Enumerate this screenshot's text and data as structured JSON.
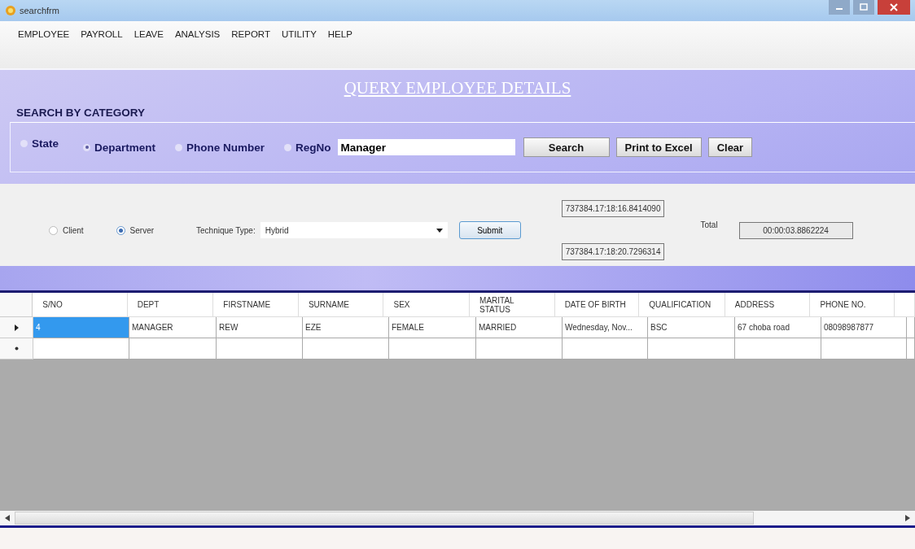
{
  "window": {
    "title": "searchfrm"
  },
  "menu": [
    {
      "label": "EMPLOYEE"
    },
    {
      "label": "PAYROLL"
    },
    {
      "label": "LEAVE"
    },
    {
      "label": "ANALYSIS"
    },
    {
      "label": "REPORT"
    },
    {
      "label": "UTILITY"
    },
    {
      "label": "HELP"
    }
  ],
  "header": {
    "title": "QUERY EMPLOYEE DETAILS"
  },
  "search_group": {
    "label": "SEARCH BY CATEGORY",
    "options": [
      {
        "label": "State",
        "selected": false
      },
      {
        "label": "Department",
        "selected": true
      },
      {
        "label": "Phone Number",
        "selected": false
      },
      {
        "label": "RegNo",
        "selected": false
      }
    ],
    "value": "Manager",
    "buttons": [
      {
        "label": "Search"
      },
      {
        "label": "Print to Excel"
      },
      {
        "label": "Clear"
      }
    ]
  },
  "technique": {
    "modes": [
      {
        "label": "Client",
        "selected": false
      },
      {
        "label": "Server",
        "selected": true
      }
    ],
    "type_label": "Technique Type:",
    "type_value": "Hybrid",
    "submit": "Submit",
    "start_time": "737384.17:18:16.8414090",
    "end_time": "737384.17:18:20.7296314",
    "total_label": "Total",
    "total_value": "00:00:03.8862224"
  },
  "table": {
    "columns": [
      "S/NO",
      "DEPT",
      "FIRSTNAME",
      "SURNAME",
      "SEX",
      "MARITAL STATUS",
      "DATE OF BIRTH",
      "QUALIFICATION",
      "ADDRESS",
      "PHONE NO."
    ],
    "rows": [
      {
        "kind": "data",
        "cells": [
          {
            "text": "4",
            "selected": true
          },
          {
            "text": "MANAGER",
            "selected": false
          },
          {
            "text": "REW",
            "selected": false
          },
          {
            "text": "EZE",
            "selected": false
          },
          {
            "text": "FEMALE",
            "selected": false
          },
          {
            "text": "MARRIED",
            "selected": false
          },
          {
            "text": "Wednesday, Nov...",
            "selected": false
          },
          {
            "text": "BSC",
            "selected": false
          },
          {
            "text": "67 choba road",
            "selected": false
          },
          {
            "text": "08098987877",
            "selected": false
          }
        ]
      },
      {
        "kind": "new",
        "cells": [
          {
            "text": "",
            "selected": false
          },
          {
            "text": "",
            "selected": false
          },
          {
            "text": "",
            "selected": false
          },
          {
            "text": "",
            "selected": false
          },
          {
            "text": "",
            "selected": false
          },
          {
            "text": "",
            "selected": false
          },
          {
            "text": "",
            "selected": false
          },
          {
            "text": "",
            "selected": false
          },
          {
            "text": "",
            "selected": false
          },
          {
            "text": "",
            "selected": false
          }
        ]
      }
    ]
  }
}
